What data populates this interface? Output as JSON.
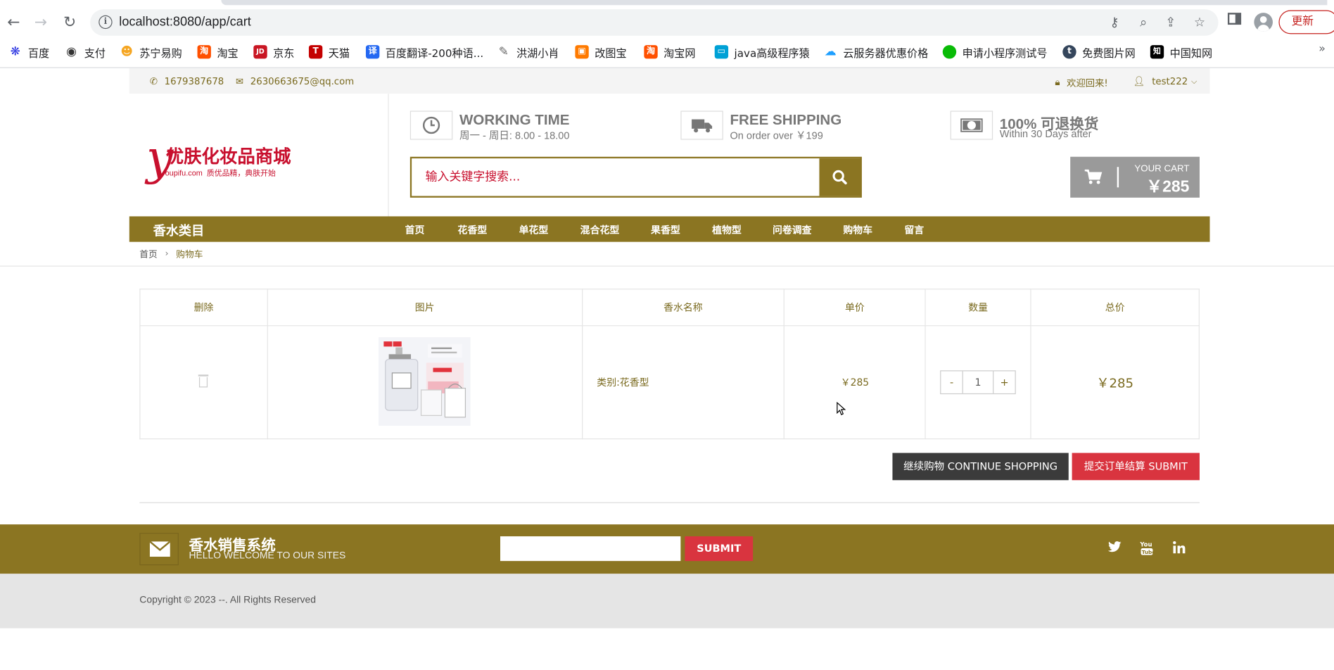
{
  "browser": {
    "url": "localhost:8080/app/cart",
    "update_label": "更新",
    "bookmarks": [
      {
        "label": "百度",
        "icon": "baidu-icon",
        "color": "#2932e1",
        "glyph": "❋"
      },
      {
        "label": "支付",
        "icon": "github-icon",
        "color": "#333333",
        "glyph": "◉"
      },
      {
        "label": "苏宁易购",
        "icon": "suning-icon",
        "color": "#f5a623",
        "glyph": "☻"
      },
      {
        "label": "淘宝",
        "icon": "taobao-icon",
        "color": "#ff5000",
        "glyph": "淘"
      },
      {
        "label": "京东",
        "icon": "jd-icon",
        "color": "#c91623",
        "glyph": "JD"
      },
      {
        "label": "天猫",
        "icon": "tmall-icon",
        "color": "#c40000",
        "glyph": "T"
      },
      {
        "label": "百度翻译-200种语...",
        "icon": "translate-icon",
        "color": "#2468f2",
        "glyph": "译"
      },
      {
        "label": "洪湖小肖",
        "icon": "pen-icon",
        "color": "#666666",
        "glyph": "✎"
      },
      {
        "label": "改图宝",
        "icon": "gaitubao-icon",
        "color": "#ff7a00",
        "glyph": "▣"
      },
      {
        "label": "淘宝网",
        "icon": "taobao-icon",
        "color": "#ff5000",
        "glyph": "淘"
      },
      {
        "label": "java高级程序猿",
        "icon": "bilibili-icon",
        "color": "#00a1d6",
        "glyph": "▭"
      },
      {
        "label": "云服务器优惠价格",
        "icon": "cloud-icon",
        "color": "#1e9fff",
        "glyph": "☁"
      },
      {
        "label": "申请小程序测试号",
        "icon": "wechat-icon",
        "color": "#09bb07",
        "glyph": "●"
      },
      {
        "label": "免费图片网",
        "icon": "tumblr-icon",
        "color": "#35465c",
        "glyph": "t"
      },
      {
        "label": "中国知网",
        "icon": "cnki-icon",
        "color": "#000000",
        "glyph": "知"
      }
    ],
    "bookmarks_more": "»"
  },
  "topbar": {
    "phone": "1679387678",
    "email": "2630663675@qq.com",
    "welcome": "欢迎回来!",
    "user": "test222"
  },
  "header": {
    "logo_letter": "y",
    "logo_title": "优肤化妆品商城",
    "logo_domain": "oupifu.com",
    "logo_slogan": "质优品精，典肤开始",
    "info": [
      {
        "title": "WORKING TIME",
        "sub": "周一 - 周日: 8.00 - 18.00",
        "icon": "clock-icon"
      },
      {
        "title": "FREE SHIPPING",
        "sub": "On order over ￥199",
        "icon": "truck-icon"
      },
      {
        "title": "100% 可退换货",
        "sub": "Within 30 Days after",
        "icon": "money-icon"
      }
    ],
    "search_placeholder": "输入关键字搜索...",
    "cart_label": "YOUR CART",
    "cart_amount": "￥285"
  },
  "nav": {
    "category_title": "香水类目",
    "items": [
      "首页",
      "花香型",
      "单花型",
      "混合花型",
      "果香型",
      "植物型",
      "问卷调查",
      "购物车",
      "留言"
    ]
  },
  "breadcrumb": {
    "home": "首页",
    "current": "购物车"
  },
  "cart": {
    "headers": [
      "删除",
      "图片",
      "香水名称",
      "单价",
      "数量",
      "总价"
    ],
    "rows": [
      {
        "name": "类别:花香型",
        "price": "￥285",
        "qty": "1",
        "total": "￥285"
      }
    ],
    "minus": "-",
    "plus": "+",
    "continue_label": "继续购物 CONTINUE SHOPPING",
    "submit_label": "提交订单结算 SUBMIT"
  },
  "footer": {
    "title": "香水销售系统",
    "subtitle": "HELLO WELCOME TO OUR SITES",
    "submit_label": "SUBMIT",
    "social": [
      "twitter-icon",
      "youtube-icon",
      "linkedin-icon"
    ],
    "copyright": "Copyright © 2023 --. All Rights Reserved"
  },
  "colors": {
    "brand": "#8b7522",
    "accent": "#d9343f",
    "logo_red": "#c8102e",
    "cart_gray": "#9a9a9a"
  }
}
